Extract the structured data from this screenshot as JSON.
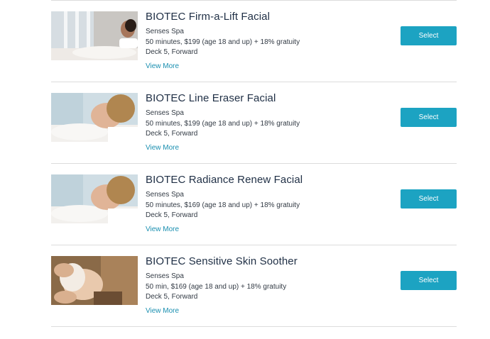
{
  "treatments": [
    {
      "title": "BIOTEC Firm-a-Lift Facial",
      "venue": "Senses Spa",
      "details": "50 minutes, $199 (age 18 and up) + 18% gratuity",
      "location": "Deck 5, Forward",
      "more_label": "View More",
      "button_label": "Select"
    },
    {
      "title": "BIOTEC Line Eraser Facial",
      "venue": "Senses Spa",
      "details": "50 minutes, $199 (age 18 and up) + 18% gratuity",
      "location": "Deck 5, Forward",
      "more_label": "View More",
      "button_label": "Select"
    },
    {
      "title": "BIOTEC Radiance Renew Facial",
      "venue": "Senses Spa",
      "details": "50 minutes, $169 (age 18 and up) + 18% gratuity",
      "location": "Deck 5, Forward",
      "more_label": "View More",
      "button_label": "Select"
    },
    {
      "title": "BIOTEC Sensitive Skin Soother",
      "venue": "Senses Spa",
      "details": "50 min, $169 (age 18 and up) + 18% gratuity",
      "location": "Deck 5, Forward",
      "more_label": "View More",
      "button_label": "Select"
    }
  ],
  "colors": {
    "accent": "#1ca3c2",
    "link": "#1a8fb0",
    "divider": "#dcdcdc"
  }
}
